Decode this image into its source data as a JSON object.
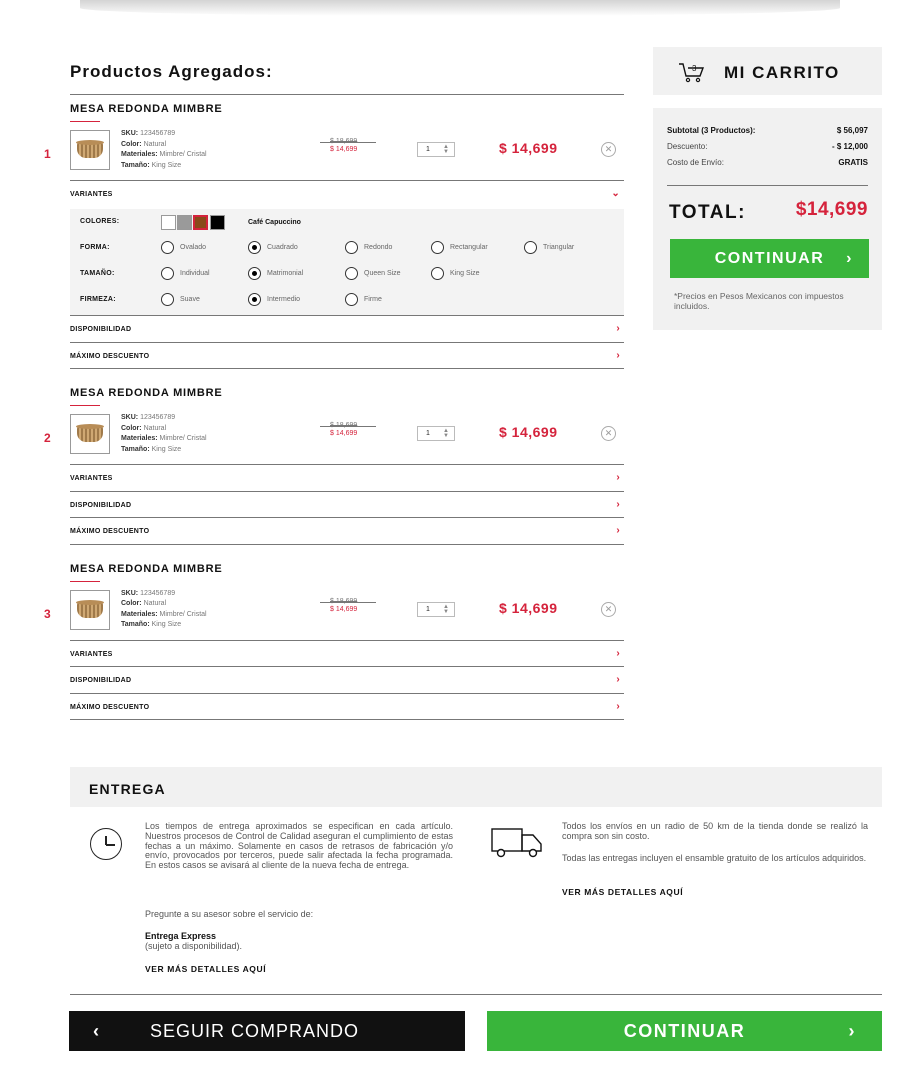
{
  "colors": {
    "accent": "#d5233c",
    "green": "#39b53b",
    "panel": "#f1f1f1"
  },
  "left": {
    "title": "Productos Agregados:"
  },
  "products": [
    {
      "index": "1",
      "name": "MESA REDONDA MIMBRE",
      "sku_label": "SKU:",
      "sku": "123456789",
      "color_label": "Color:",
      "color": "Natural",
      "materials_label": "Materiales:",
      "materials": "Mimbre/ Cristal",
      "size_label": "Tamaño:",
      "size": "King Size",
      "old_price": "$ 18,699",
      "new_price": "$ 14,699",
      "qty": "1",
      "price": "$ 14,699",
      "accordions": [
        "VARIANTES",
        "DISPONIBILIDAD",
        "MÁXIMO DESCUENTO"
      ]
    },
    {
      "index": "2",
      "name": "MESA REDONDA MIMBRE",
      "sku_label": "SKU:",
      "sku": "123456789",
      "color_label": "Color:",
      "color": "Natural",
      "materials_label": "Materiales:",
      "materials": "Mimbre/ Cristal",
      "size_label": "Tamaño:",
      "size": "King Size",
      "old_price": "$ 18,699",
      "new_price": "$ 14,699",
      "qty": "1",
      "price": "$ 14,699",
      "accordions": [
        "VARIANTES",
        "DISPONIBILIDAD",
        "MÁXIMO DESCUENTO"
      ]
    },
    {
      "index": "3",
      "name": "MESA REDONDA MIMBRE",
      "sku_label": "SKU:",
      "sku": "123456789",
      "color_label": "Color:",
      "color": "Natural",
      "materials_label": "Materiales:",
      "materials": "Mimbre/ Cristal",
      "size_label": "Tamaño:",
      "size": "King Size",
      "old_price": "$ 18,699",
      "new_price": "$ 14,699",
      "qty": "1",
      "price": "$ 14,699",
      "accordions": [
        "VARIANTES",
        "DISPONIBILIDAD",
        "MÁXIMO DESCUENTO"
      ]
    }
  ],
  "variants": {
    "colors_label": "COLORES:",
    "color_selected": "Café Capuccino",
    "swatches": [
      "#ffffff",
      "#9a9a9a",
      "#8a4a1a",
      "#000000"
    ],
    "forma_label": "FORMA:",
    "forma": [
      "Ovalado",
      "Cuadrado",
      "Redondo",
      "Rectangular",
      "Triangular"
    ],
    "forma_selected": "Cuadrado",
    "tamano_label": "TAMAÑO:",
    "tamano": [
      "Individual",
      "Matrimonial",
      "Queen Size",
      "King Size"
    ],
    "tamano_selected": "Matrimonial",
    "firmeza_label": "FIRMEZA:",
    "firmeza": [
      "Suave",
      "Intermedio",
      "Firme"
    ],
    "firmeza_selected": "Intermedio"
  },
  "cart": {
    "badge": "3",
    "title": "MI CARRITO",
    "subtotal_label": "Subtotal (3 Productos):",
    "subtotal": "$ 56,097",
    "discount_label": "Descuento:",
    "discount": "- $ 12,000",
    "shipping_label": "Costo de Envío:",
    "shipping": "GRATIS",
    "total_label": "TOTAL:",
    "total": "$14,699",
    "continue": "CONTINUAR",
    "note": "*Precios en Pesos Mexicanos con impuestos incluidos."
  },
  "delivery": {
    "title": "ENTREGA",
    "text1": "Los tiempos de entrega aproximados se especifican en cada artículo. Nuestros procesos de Control de Calidad aseguran el cumplimiento de estas fechas a un máximo. Solamente en casos de retrasos de fabricación y/o envío, provocados por terceros, puede salir afectada la fecha programada. En estos casos se avisará al cliente de la nueva fecha de entrega.",
    "text2": "Pregunte a su asesor sobre el servicio de:",
    "express_title": "Entrega Express",
    "express_sub": "(sujeto a disponibilidad).",
    "link_left": "VER MÁS DETALLES AQUÍ",
    "text3": "Todos los envíos en un radio de 50 km de la tienda donde se realizó la compra son sin costo.",
    "text4": "Todas las entregas incluyen el ensamble gratuito de los artículos adquiridos.",
    "link_right": "VER MÁS DETALLES AQUÍ"
  },
  "footer": {
    "back": "SEGUIR COMPRANDO",
    "continue": "CONTINUAR"
  }
}
